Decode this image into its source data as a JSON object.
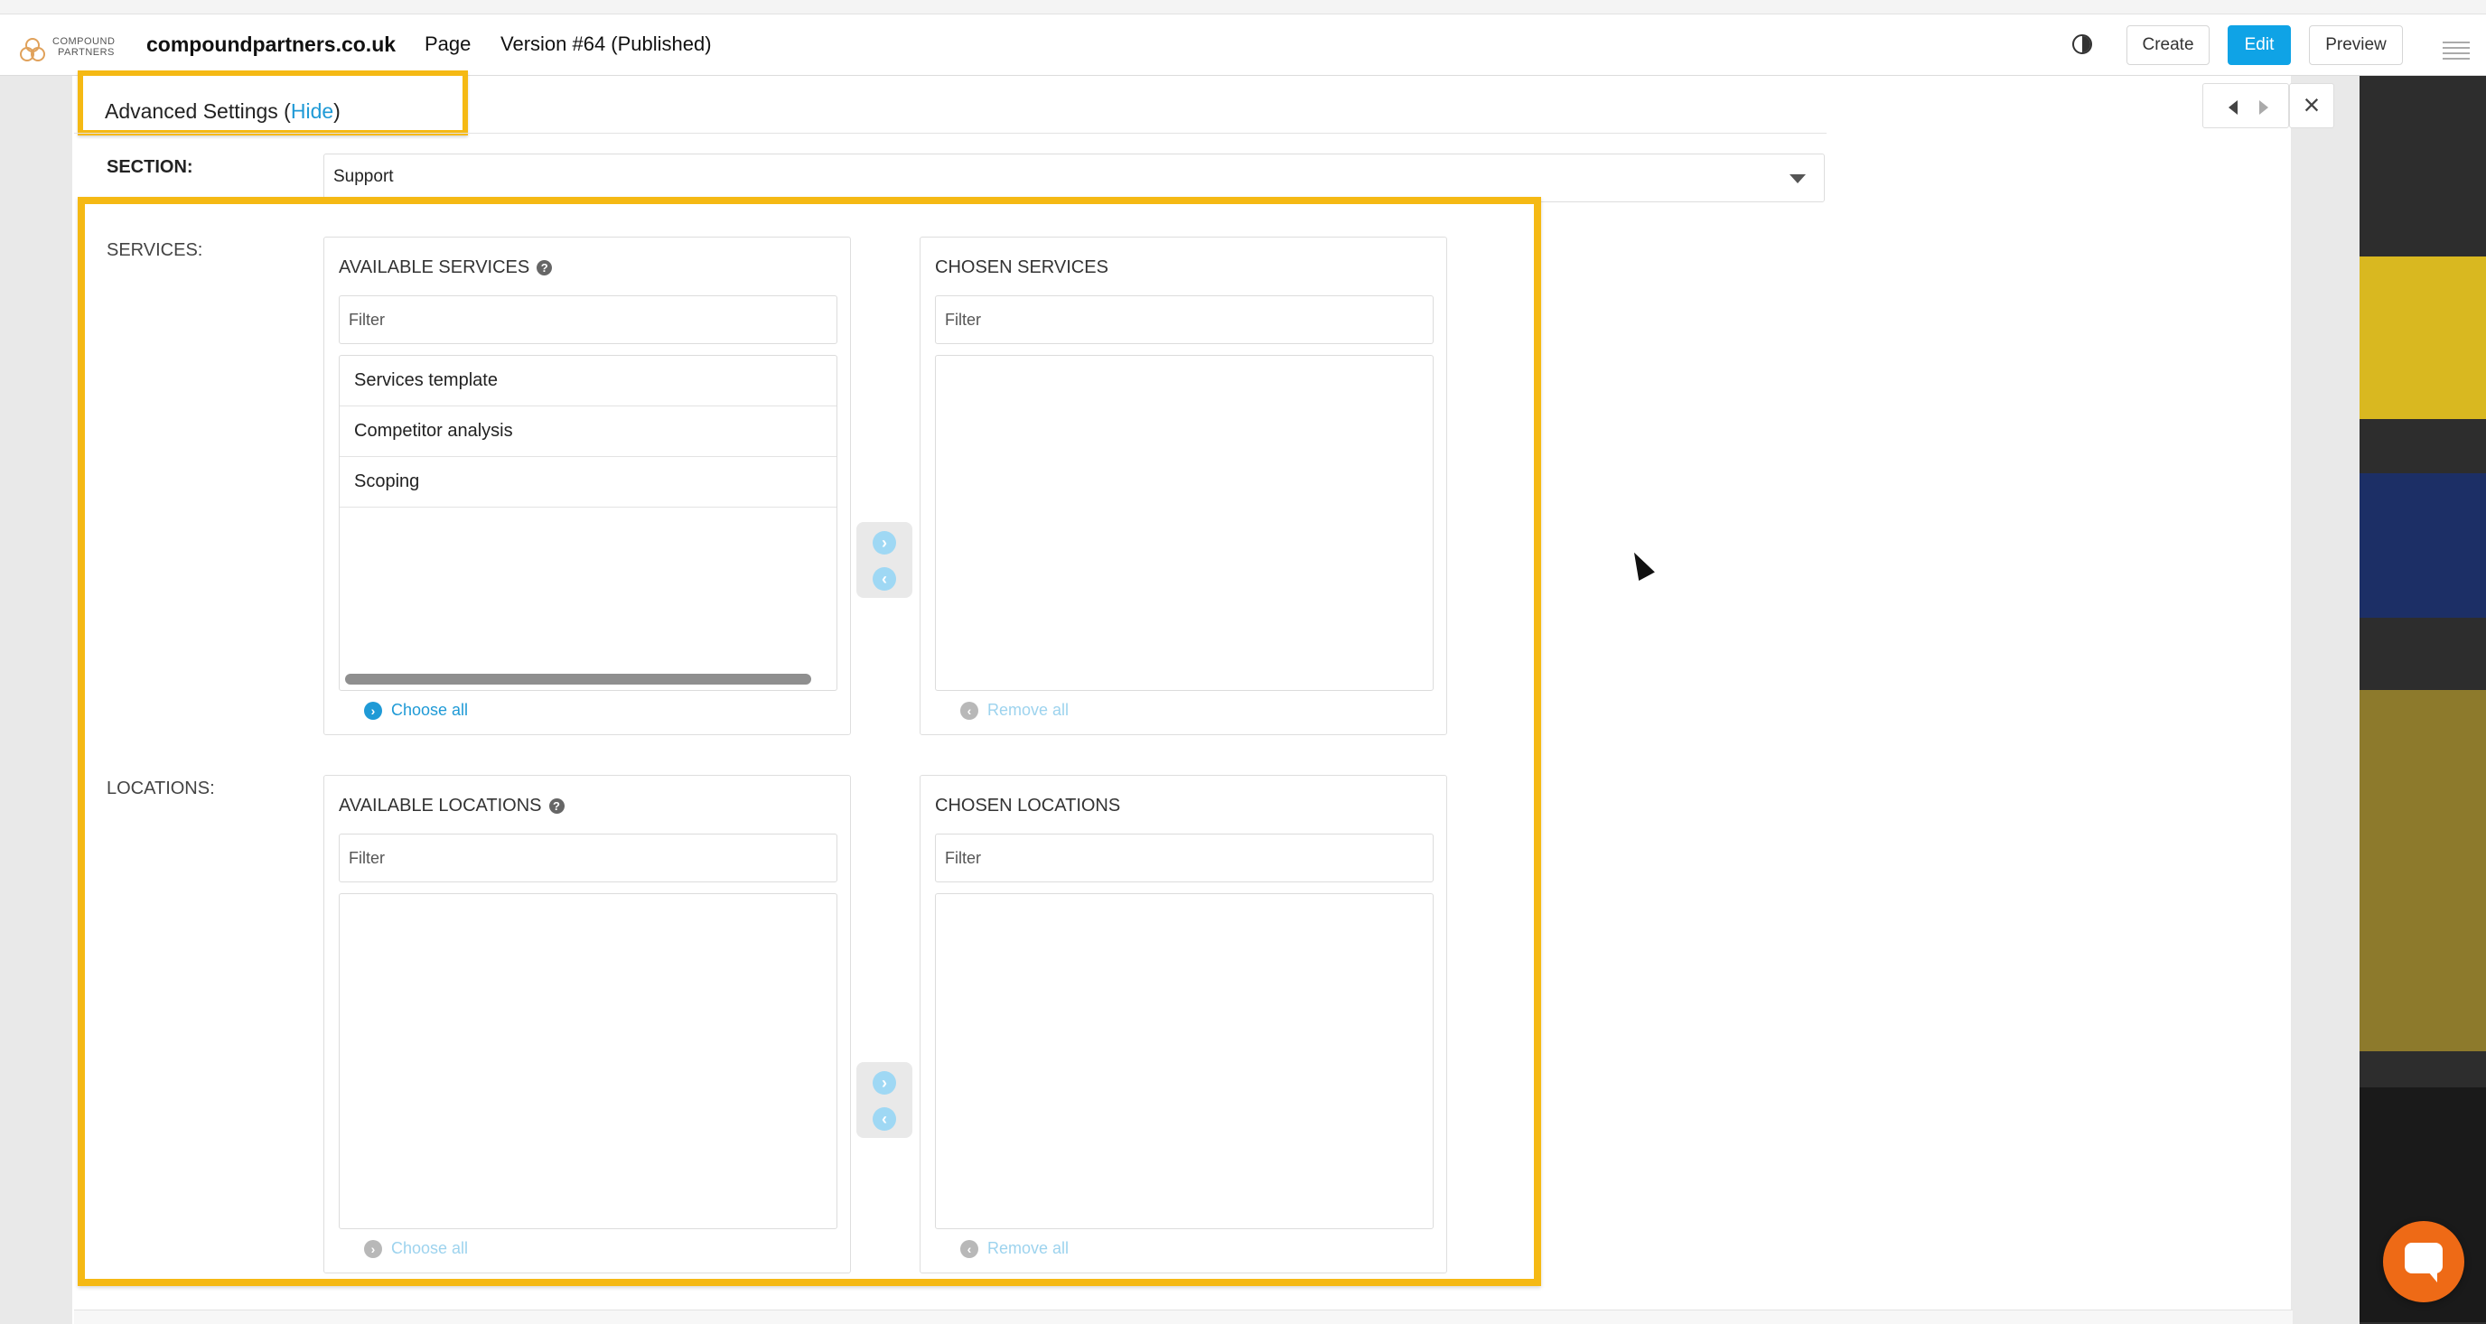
{
  "app": {
    "logo_text_line1": "COMPOUND",
    "logo_text_line2": "PARTNERS",
    "site_name": "compoundpartners.co.uk",
    "page_label": "Page",
    "version_label": "Version #64 (Published)"
  },
  "toolbar": {
    "create_label": "Create",
    "edit_label": "Edit",
    "preview_label": "Preview"
  },
  "advanced": {
    "title": "Advanced Settings (",
    "hide_label": "Hide",
    "title_end": ")"
  },
  "section": {
    "label": "SECTION:",
    "selected": "Support"
  },
  "services": {
    "label": "SERVICES:",
    "available": {
      "title": "AVAILABLE SERVICES",
      "filter_placeholder": "Filter",
      "items": [
        "Services template",
        "Competitor analysis",
        "Scoping"
      ],
      "action_label": "Choose all"
    },
    "chosen": {
      "title": "CHOSEN SERVICES",
      "filter_placeholder": "Filter",
      "items": [],
      "action_label": "Remove all"
    }
  },
  "locations": {
    "label": "LOCATIONS:",
    "available": {
      "title": "AVAILABLE LOCATIONS",
      "filter_placeholder": "Filter",
      "items": [],
      "action_label": "Choose all"
    },
    "chosen": {
      "title": "CHOSEN LOCATIONS",
      "filter_placeholder": "Filter",
      "items": [],
      "action_label": "Remove all"
    }
  },
  "icons": {
    "contrast": "contrast-icon",
    "menu": "hamburger-menu-icon",
    "prev": "triangle-left-icon",
    "next": "triangle-right-icon",
    "close": "close-icon",
    "help": "question-circle-icon",
    "chat": "chat-bubble-icon"
  },
  "colors": {
    "accent": "#0fa3e6",
    "link": "#1f9ad6",
    "highlight": "#f5b914",
    "chat": "#ee6a16"
  }
}
